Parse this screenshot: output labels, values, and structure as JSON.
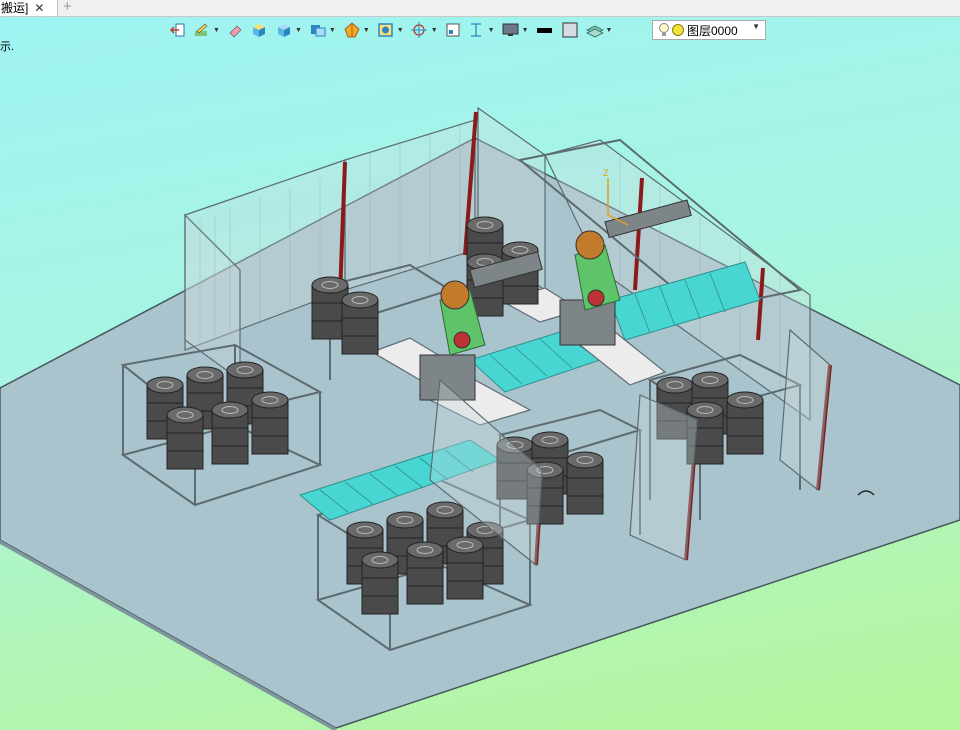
{
  "document_tab": {
    "label": "搬运]",
    "close_glyph": "✕",
    "new_tab_glyph": "+"
  },
  "viewport_hint": "示.",
  "toolbar": {
    "buttons": [
      {
        "name": "exit-sketch-button",
        "icon": "arrow-exit-icon",
        "dropdown": false
      },
      {
        "name": "sketch-tools-button",
        "icon": "sketch-pencil-icon",
        "dropdown": true
      },
      {
        "name": "eraser-button",
        "icon": "eraser-icon",
        "dropdown": false
      },
      {
        "name": "shaded-box-button",
        "icon": "shaded-cube-icon",
        "dropdown": false
      },
      {
        "name": "solid-box-button",
        "icon": "solid-cube-icon",
        "dropdown": true
      },
      {
        "name": "view-orientation-button",
        "icon": "view-cube-icon",
        "dropdown": true
      },
      {
        "name": "display-style-button",
        "icon": "sphere-icon",
        "dropdown": true
      },
      {
        "name": "render-mode-button",
        "icon": "render-icon",
        "dropdown": true
      },
      {
        "name": "snap-point-button",
        "icon": "target-icon",
        "dropdown": true
      },
      {
        "name": "frame-button",
        "icon": "frame-icon",
        "dropdown": false
      },
      {
        "name": "dimension-button",
        "icon": "dimension-icon",
        "dropdown": true
      },
      {
        "name": "monitor-view-button",
        "icon": "monitor-icon",
        "dropdown": true
      },
      {
        "name": "line-color-button",
        "icon": "black-line-icon",
        "dropdown": false
      },
      {
        "name": "fill-color-button",
        "icon": "gray-square-icon",
        "dropdown": false
      },
      {
        "name": "layers-button",
        "icon": "layers-icon",
        "dropdown": true
      }
    ],
    "layer_select": {
      "value": "图层0000",
      "bulb_icon": "lightbulb-icon",
      "color_icon": "yellow-circle-icon"
    }
  },
  "colors": {
    "floor": "#a9c4cd",
    "frame": "#5d6b70",
    "conveyor": "#48d6d3",
    "barrel": "#4a4a4a",
    "robot_orange": "#c27a2c",
    "robot_green": "#5fc36a",
    "robot_gray": "#7e8588",
    "fence_post_red": "#8c1a1a",
    "fence_mesh": "#7a8a90"
  },
  "scene": {
    "name": "robot-palletizing-cell",
    "robots": 2,
    "pallet_stations": 5
  }
}
